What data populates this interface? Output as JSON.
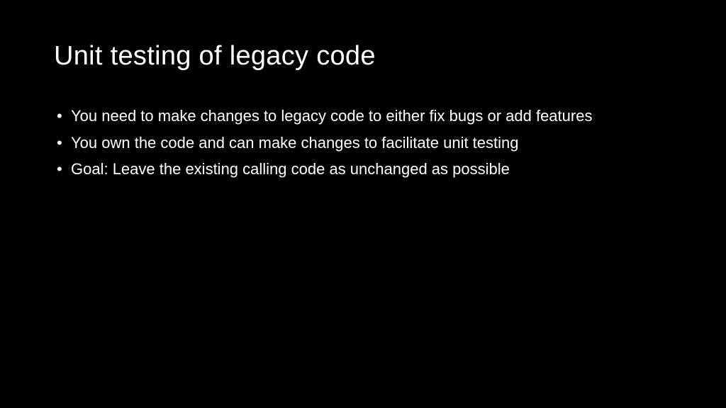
{
  "slide": {
    "title": "Unit testing of legacy code",
    "bullets": [
      "You need to make changes to legacy code to either fix bugs or add features",
      "You own the code and can make changes to facilitate unit testing",
      "Goal: Leave the existing calling code as unchanged as possible"
    ]
  }
}
